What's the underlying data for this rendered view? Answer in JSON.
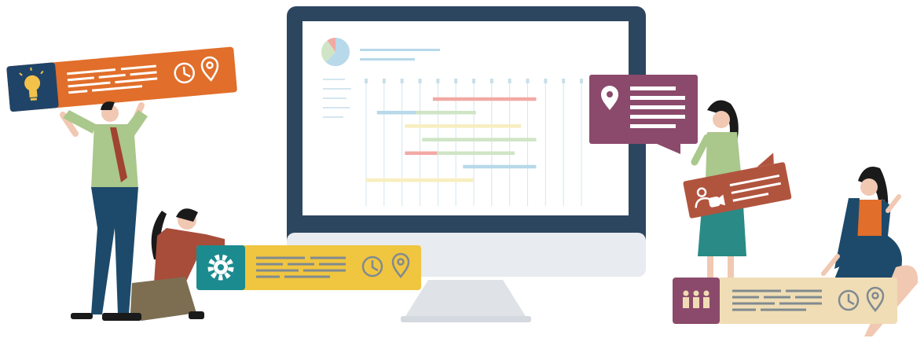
{
  "colors": {
    "monitor_frame": "#2d4660",
    "screen": "#ffffff",
    "stand": "#dfe3e8",
    "orange_card": "#e16e2a",
    "navy_icon_box": "#1f4468",
    "yellow_card": "#f0c53f",
    "teal_icon_box": "#1b8b8f",
    "plum_bubble": "#8b4a6b",
    "rust_bubble": "#b1543e",
    "beige_card": "#f0ddb5",
    "purple_icon_box": "#8b4a6b",
    "line_gray": "#808a90"
  },
  "icons": {
    "lightbulb": "lightbulb-icon",
    "clock": "clock-icon",
    "location": "location-pin-icon",
    "gear": "gear-icon",
    "video_contact": "video-contact-icon",
    "team": "team-icon",
    "pie": "pie-chart-icon"
  },
  "gantt": {
    "bars": [
      {
        "row": 0,
        "start": 0.31,
        "end": 0.79,
        "color": "#f2a9a4"
      },
      {
        "row": 1,
        "start": 0.05,
        "end": 0.42,
        "color": "#b7d9ea"
      },
      {
        "row": 1,
        "start": 0.23,
        "end": 0.51,
        "color": "#cfe5c5"
      },
      {
        "row": 2,
        "start": 0.18,
        "end": 0.72,
        "color": "#f7eec0"
      },
      {
        "row": 3,
        "start": 0.26,
        "end": 0.79,
        "color": "#cfe5c5"
      },
      {
        "row": 4,
        "start": 0.18,
        "end": 0.33,
        "color": "#f2a9a4"
      },
      {
        "row": 4,
        "start": 0.33,
        "end": 0.69,
        "color": "#cfe5c5"
      },
      {
        "row": 5,
        "start": 0.45,
        "end": 0.79,
        "color": "#b7d9ea"
      },
      {
        "row": 6,
        "start": 0.0,
        "end": 0.5,
        "color": "#f7eec0"
      }
    ],
    "pie": [
      {
        "value": 0.62,
        "color": "#b7d9ea"
      },
      {
        "value": 0.28,
        "color": "#cfe5c5"
      },
      {
        "value": 0.1,
        "color": "#f2a9a4"
      }
    ]
  }
}
